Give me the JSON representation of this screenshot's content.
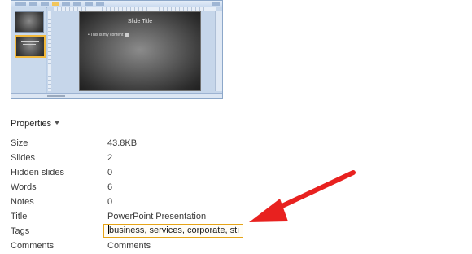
{
  "thumbnail": {
    "slide_title": "Slide Title",
    "bullet_text": "This is my content"
  },
  "properties": {
    "header": "Properties",
    "rows": [
      {
        "label": "Size",
        "value": "43.8KB"
      },
      {
        "label": "Slides",
        "value": "2"
      },
      {
        "label": "Hidden slides",
        "value": "0"
      },
      {
        "label": "Words",
        "value": "6"
      },
      {
        "label": "Notes",
        "value": "0"
      },
      {
        "label": "Title",
        "value": "PowerPoint Presentation"
      },
      {
        "label": "Tags",
        "value": "business, services, corporate, stı"
      },
      {
        "label": "Comments",
        "value": "Comments"
      }
    ]
  },
  "annotation": {
    "arrow_color": "#e8211f",
    "tags_border_color": "#e6a417"
  }
}
